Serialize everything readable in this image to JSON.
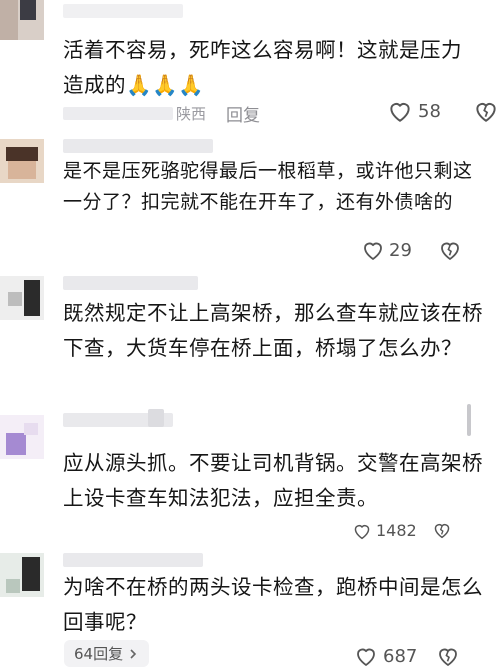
{
  "comments": [
    {
      "text_line1": "活着不容易，死咋这么容易啊！这就是压力",
      "text_line2": "造成的🙏🙏🙏",
      "location": "陕西",
      "reply_label": "回复",
      "likes": "58"
    },
    {
      "text": "是不是压死骆驼得最后一根稻草，或许他只剩这一分了？扣完就不能在开车了，还有外债啥的",
      "likes": "29"
    },
    {
      "text": "既然规定不让上高架桥，那么查车就应该在桥下查，大货车停在桥上面，桥塌了怎么办？"
    },
    {
      "text": "应从源头抓。不要让司机背锅。交警在高架桥上设卡查车知法犯法，应担全责。",
      "likes": "1482"
    },
    {
      "text": "为啥不在桥的两头设卡检查，跑桥中间是怎么回事呢？",
      "replies_label": "64回复",
      "likes": "687"
    }
  ],
  "icons": {
    "like": "heart-outline-icon",
    "dislike": "broken-heart-icon",
    "expand": "chevron-right-icon"
  }
}
